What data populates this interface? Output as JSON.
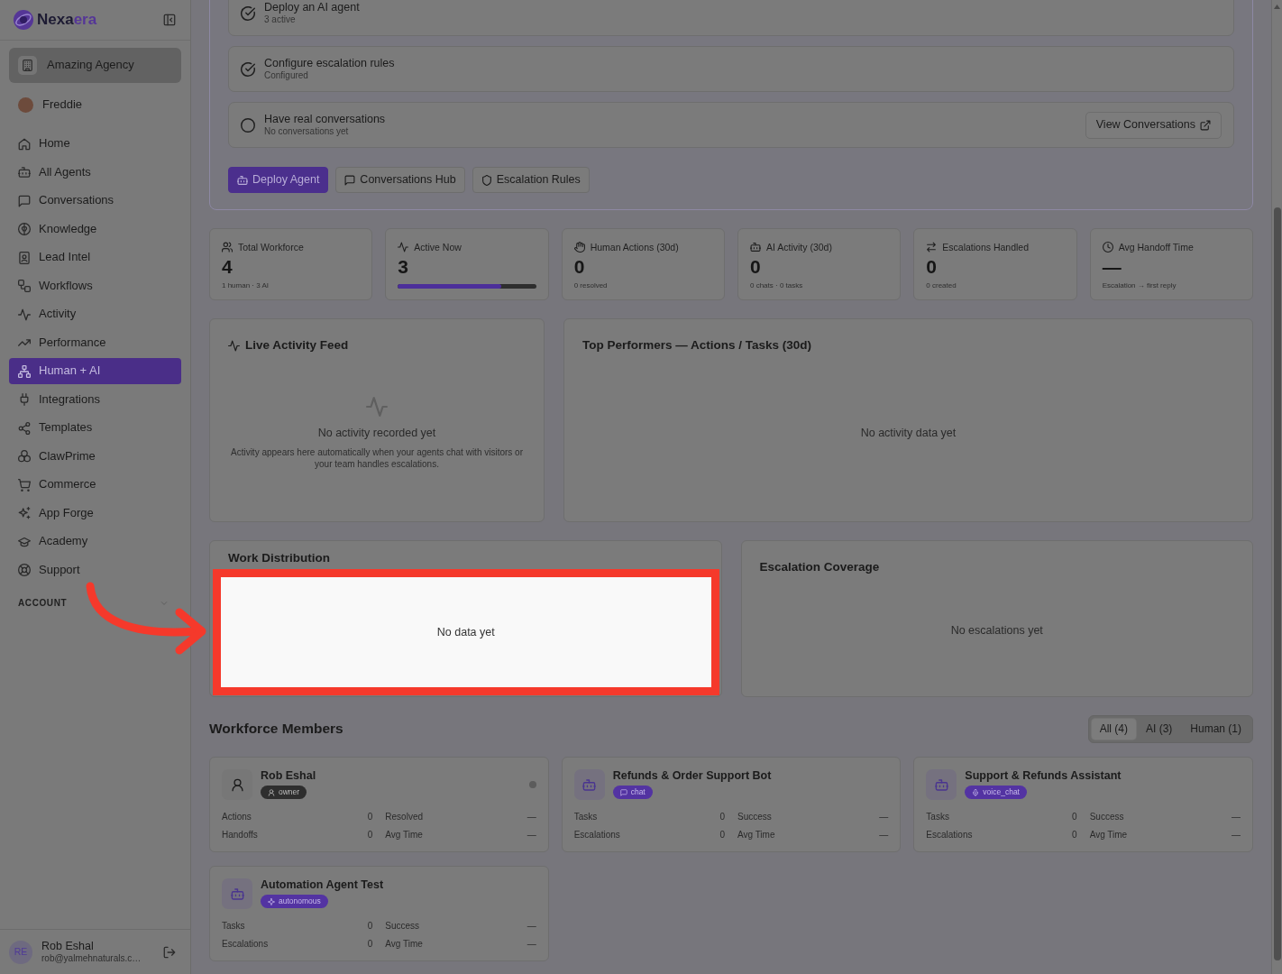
{
  "sidebar": {
    "logo": [
      "Nexa",
      "era"
    ],
    "workspace": "Amazing Agency",
    "user": "Freddie",
    "nav": [
      {
        "label": "Home",
        "selected": false
      },
      {
        "label": "All Agents",
        "selected": false
      },
      {
        "label": "Conversations",
        "selected": false
      },
      {
        "label": "Knowledge",
        "selected": false
      },
      {
        "label": "Lead Intel",
        "selected": false
      },
      {
        "label": "Workflows",
        "selected": false
      },
      {
        "label": "Activity",
        "selected": false
      },
      {
        "label": "Performance",
        "selected": false
      },
      {
        "label": "Human + AI",
        "selected": true
      },
      {
        "label": "Integrations",
        "selected": false
      },
      {
        "label": "Templates",
        "selected": false
      },
      {
        "label": "ClawPrime",
        "selected": false
      },
      {
        "label": "Commerce",
        "selected": false
      },
      {
        "label": "App Forge",
        "selected": false
      },
      {
        "label": "Academy",
        "selected": false
      },
      {
        "label": "Support",
        "selected": false
      }
    ],
    "section": "ACCOUNT",
    "account": {
      "initials": "RE",
      "name": "Rob Eshal",
      "email": "rob@yalmehnaturals.c…"
    }
  },
  "setup": {
    "steps": [
      {
        "title": "Deploy an AI agent",
        "status": "3 active",
        "checked": true
      },
      {
        "title": "Configure escalation rules",
        "status": "Configured",
        "checked": true
      },
      {
        "title": "Have real conversations",
        "status": "No conversations yet",
        "checked": false,
        "action": "View Conversations"
      }
    ],
    "buttons": [
      {
        "label": "Deploy Agent",
        "kind": "primary"
      },
      {
        "label": "Conversations Hub",
        "kind": "outline"
      },
      {
        "label": "Escalation Rules",
        "kind": "outline"
      }
    ]
  },
  "stats": [
    {
      "label": "Total Workforce",
      "value": "4",
      "note": "1 human · 3 AI"
    },
    {
      "label": "Active Now",
      "value": "3",
      "level": 0.75
    },
    {
      "label": "Human Actions (30d)",
      "value": "0",
      "note": "0 resolved"
    },
    {
      "label": "AI Activity (30d)",
      "value": "0",
      "note": "0 chats · 0 tasks"
    },
    {
      "label": "Escalations Handled",
      "value": "0",
      "note": "0 created"
    },
    {
      "label": "Avg Handoff Time",
      "value": "—",
      "note": "Escalation → first reply"
    }
  ],
  "live_feed": {
    "title": "Live Activity Feed",
    "empty_title": "No activity recorded yet",
    "empty_text": "Activity appears here automatically when your agents chat with visitors or your team handles escalations."
  },
  "top_performers": {
    "title": "Top Performers — Actions / Tasks (30d)",
    "empty_text": "No activity data yet"
  },
  "work_distribution": {
    "title": "Work Distribution",
    "empty_text": "No data yet",
    "highlighted": true
  },
  "escalation_coverage": {
    "title": "Escalation Coverage",
    "empty_text": "No escalations yet"
  },
  "workforce": {
    "title": "Workforce Members",
    "filters": [
      {
        "label": "All (4)",
        "selected": true
      },
      {
        "label": "AI (3)",
        "selected": false
      },
      {
        "label": "Human (1)",
        "selected": false
      }
    ],
    "members": [
      {
        "name": "Rob Eshal",
        "kind": "human",
        "badge": "owner",
        "online": false,
        "metrics": [
          {
            "label": "Actions",
            "value": "0"
          },
          {
            "label": "Resolved",
            "value": "—"
          },
          {
            "label": "Handoffs",
            "value": "0"
          },
          {
            "label": "Avg Time",
            "value": "—"
          }
        ]
      },
      {
        "name": "Refunds & Order Support Bot",
        "kind": "ai",
        "badge": "chat",
        "metrics": [
          {
            "label": "Tasks",
            "value": "0"
          },
          {
            "label": "Success",
            "value": "—"
          },
          {
            "label": "Escalations",
            "value": "0"
          },
          {
            "label": "Avg Time",
            "value": "—"
          }
        ]
      },
      {
        "name": "Support & Refunds Assistant",
        "kind": "ai",
        "badge": "voice_chat",
        "metrics": [
          {
            "label": "Tasks",
            "value": "0"
          },
          {
            "label": "Success",
            "value": "—"
          },
          {
            "label": "Escalations",
            "value": "0"
          },
          {
            "label": "Avg Time",
            "value": "—"
          }
        ]
      },
      {
        "name": "Automation Agent Test",
        "kind": "ai",
        "badge": "autonomous",
        "metrics": [
          {
            "label": "Tasks",
            "value": "0"
          },
          {
            "label": "Success",
            "value": "—"
          },
          {
            "label": "Escalations",
            "value": "0"
          },
          {
            "label": "Avg Time",
            "value": "—"
          }
        ]
      }
    ]
  },
  "annotation": {
    "arrow": true
  }
}
